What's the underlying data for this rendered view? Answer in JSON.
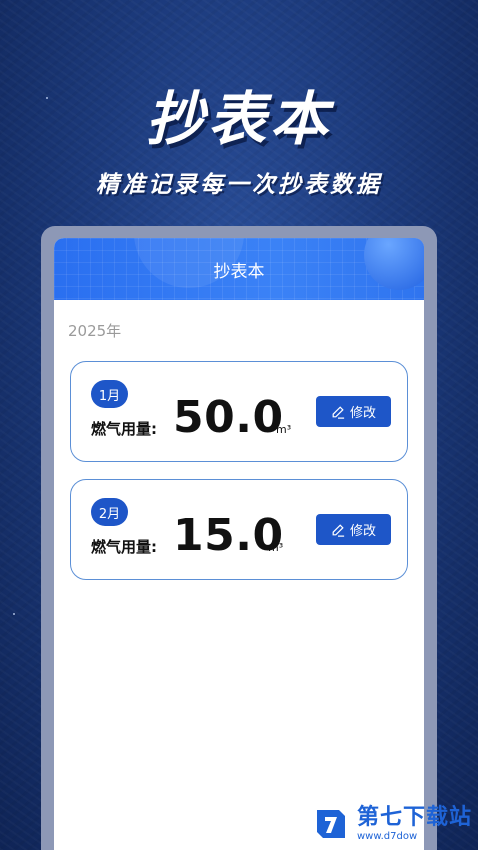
{
  "promo": {
    "headline": "抄表本",
    "subheadline": "精准记录每一次抄表数据"
  },
  "app": {
    "title": "抄表本",
    "year_label": "2025年",
    "records": [
      {
        "month": "1月",
        "label": "燃气用量:",
        "value": "50.0",
        "unit": "m³",
        "edit_label": "修改"
      },
      {
        "month": "2月",
        "label": "燃气用量:",
        "value": "15.0",
        "unit": "m³",
        "edit_label": "修改"
      }
    ]
  },
  "watermark": {
    "name": "第七下载站",
    "url": "www.d7dow"
  },
  "colors": {
    "accent": "#1e56c8",
    "header": "#3b82f6",
    "card_border": "#5b8fd6"
  },
  "icons": {
    "edit": "pencil-icon"
  }
}
